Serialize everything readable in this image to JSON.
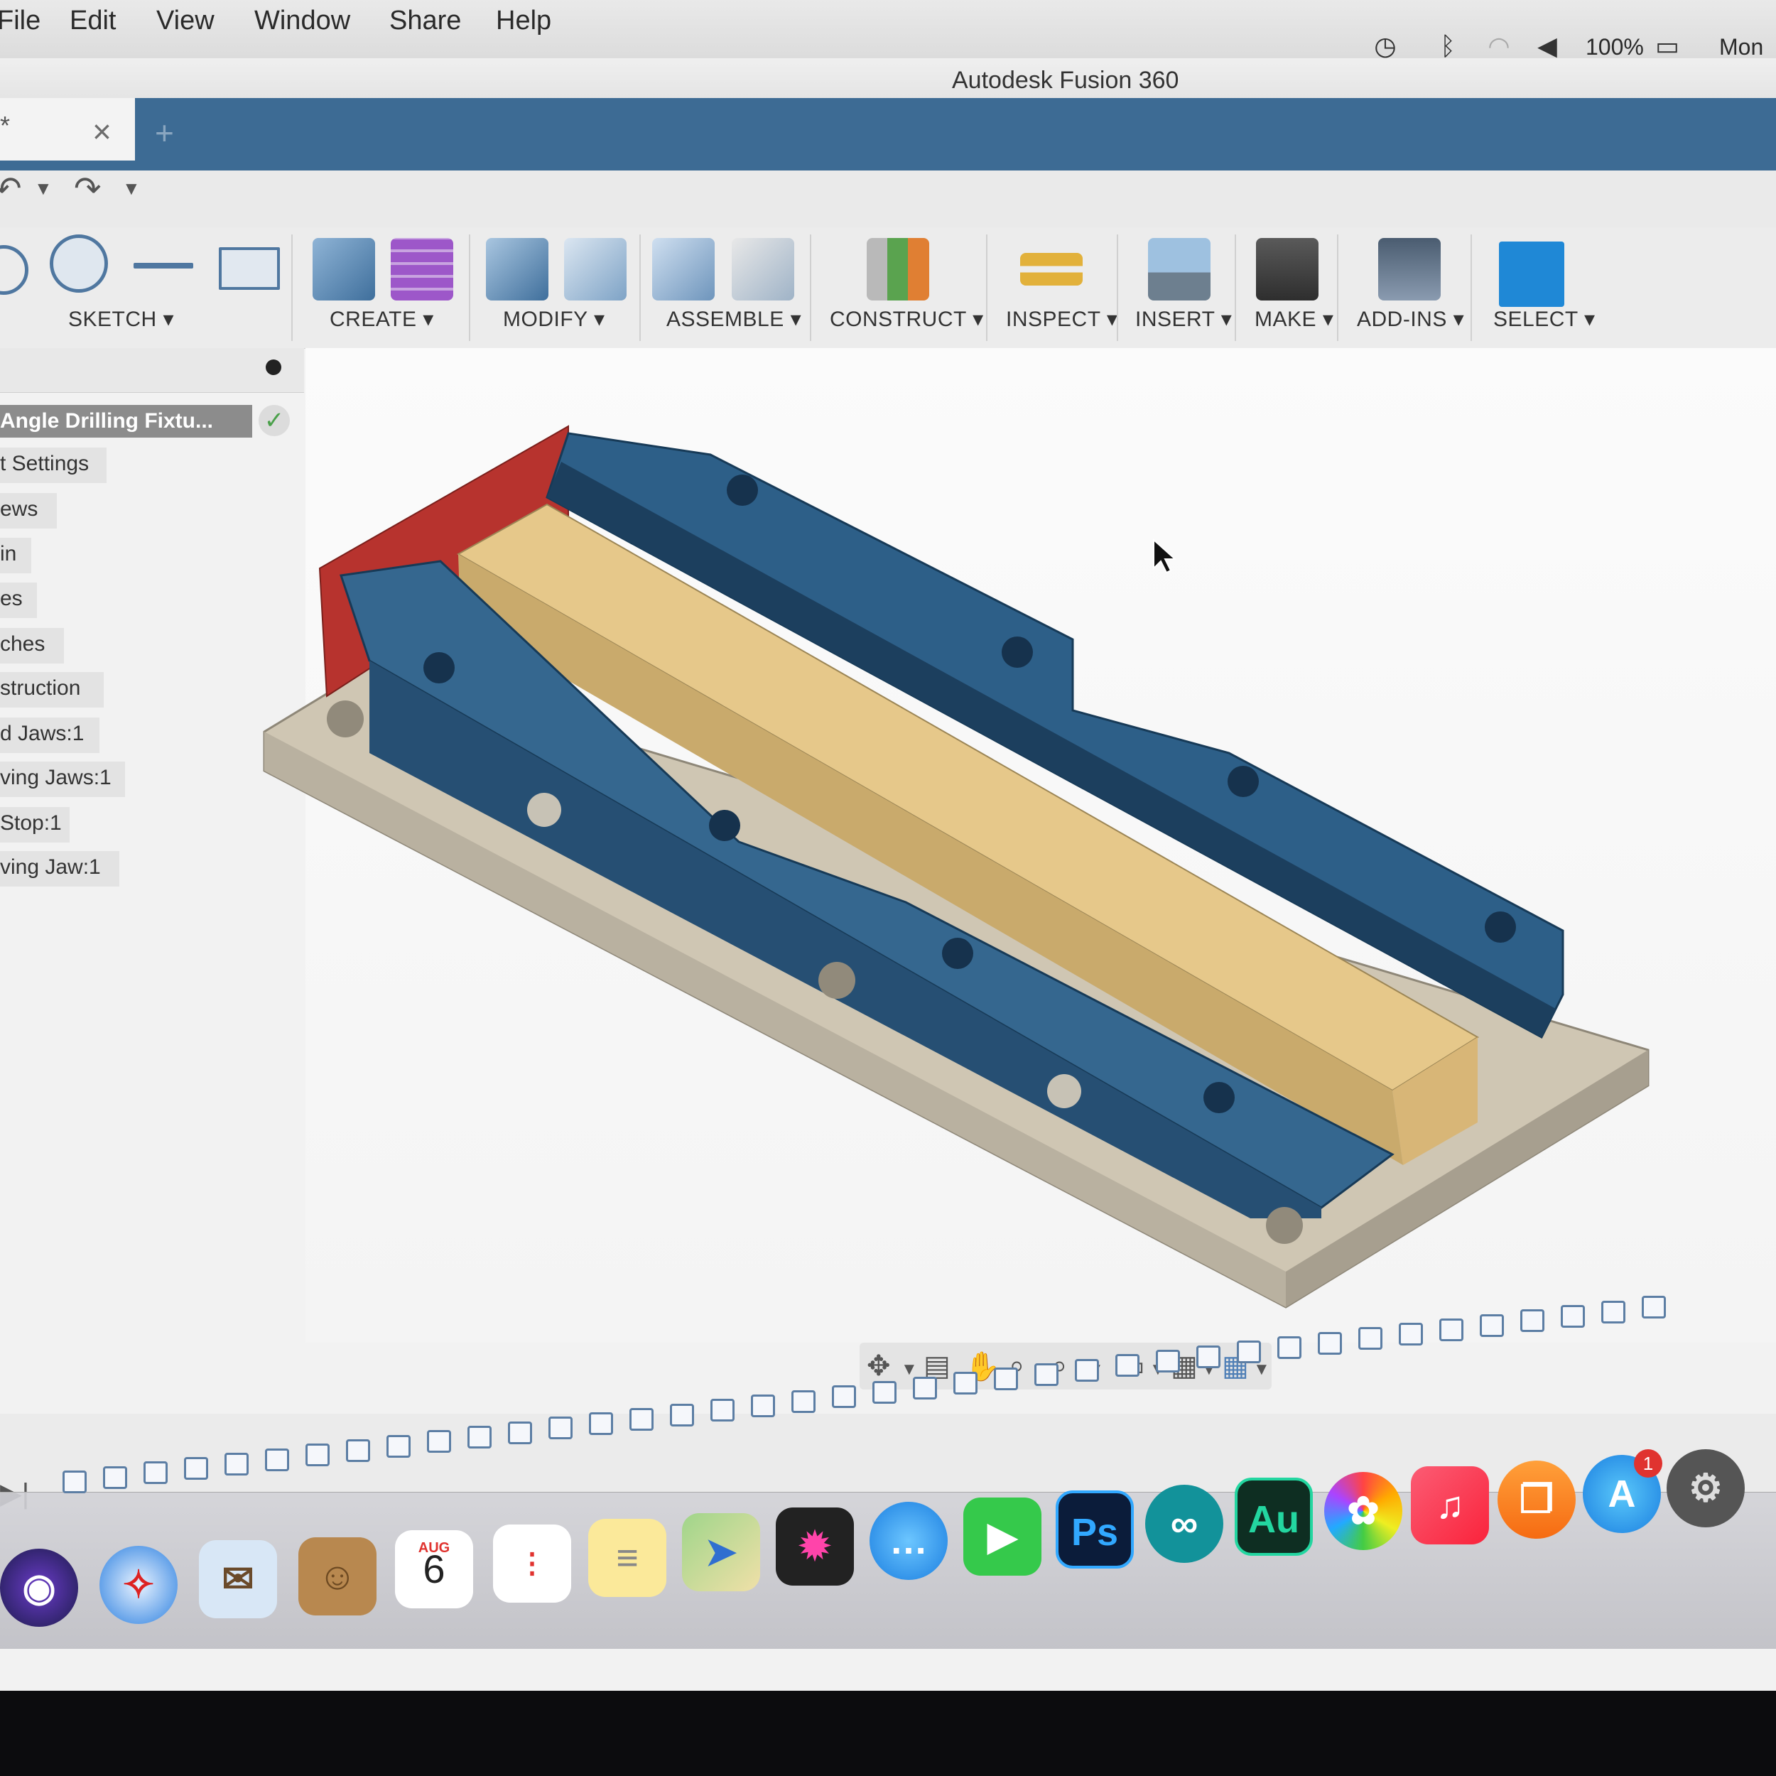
{
  "menubar": {
    "items": [
      "File",
      "Edit",
      "View",
      "Window",
      "Share",
      "Help"
    ],
    "battery": "100%",
    "clock": "Mon"
  },
  "window": {
    "title": "Autodesk Fusion 360"
  },
  "tab": {
    "doc_suffix": "*",
    "close": "×",
    "plus": "+"
  },
  "toolbar": {
    "groups": [
      "SKETCH ▾",
      "CREATE ▾",
      "MODIFY ▾",
      "ASSEMBLE ▾",
      "CONSTRUCT ▾",
      "INSPECT ▾",
      "INSERT ▾",
      "MAKE ▾",
      "ADD-INS ▾",
      "SELECT ▾"
    ]
  },
  "browser": {
    "root": "Angle Drilling Fixtu...",
    "items": [
      "t Settings",
      "ews",
      "in",
      "es",
      "ches",
      "struction",
      "d Jaws:1",
      "ving Jaws:1",
      "Stop:1",
      "ving Jaw:1"
    ]
  },
  "dock": {
    "calendar_month": "AUG",
    "calendar_day": "6",
    "photoshop": "Ps",
    "audition": "Au",
    "appstore_badge": "1"
  },
  "colors": {
    "accent_blue": "#3d6b94",
    "part_blue": "#2d5f88",
    "part_gold": "#e6c88a",
    "part_red": "#b7332e",
    "base_plate": "#cfc6b3"
  }
}
